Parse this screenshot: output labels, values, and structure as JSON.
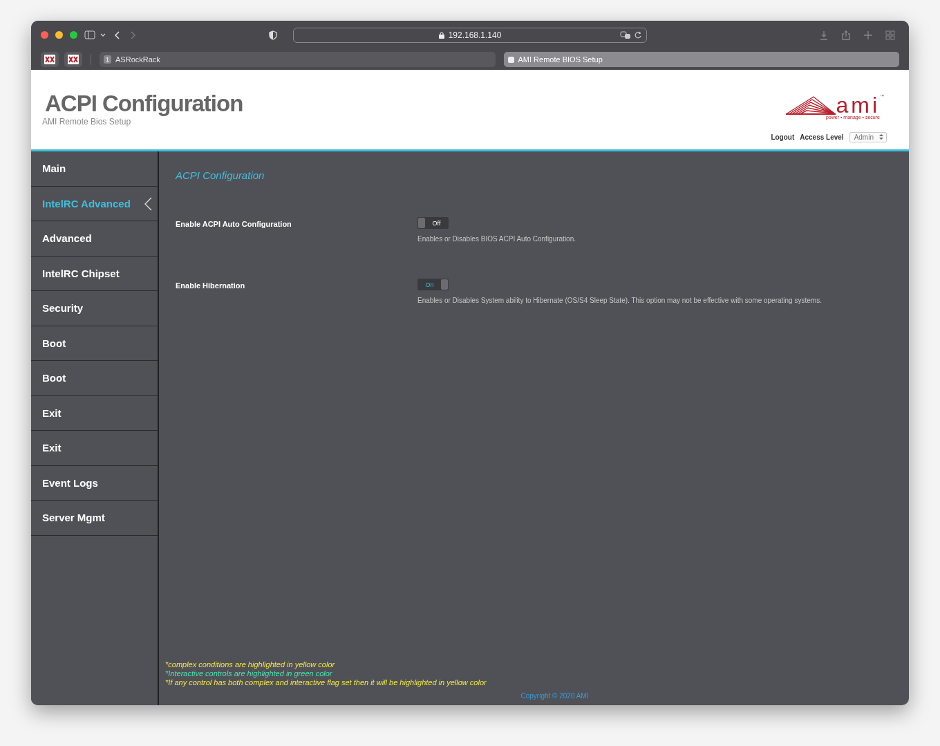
{
  "browser": {
    "url": "192.168.1.140",
    "tabs": [
      {
        "label": "ASRockRack",
        "badge": "1",
        "selected": false
      },
      {
        "label": "AMI Remote BIOS Setup",
        "selected": true
      }
    ]
  },
  "header": {
    "title": "ACPI Configuration",
    "subtitle": "AMI Remote Bios Setup",
    "logo": {
      "wordmark": "ami",
      "tm": "™",
      "tagline": "power • manage • secure"
    },
    "logout": "Logout",
    "access_level_label": "Access Level",
    "access_level": "Admin"
  },
  "sidebar": {
    "items": [
      {
        "label": "Main",
        "selected": false
      },
      {
        "label": "IntelRC Advanced",
        "selected": true
      },
      {
        "label": "Advanced",
        "selected": false
      },
      {
        "label": "IntelRC Chipset",
        "selected": false
      },
      {
        "label": "Security",
        "selected": false
      },
      {
        "label": "Boot",
        "selected": false
      },
      {
        "label": "Boot",
        "selected": false
      },
      {
        "label": "Exit",
        "selected": false
      },
      {
        "label": "Exit",
        "selected": false
      },
      {
        "label": "Event Logs",
        "selected": false
      },
      {
        "label": "Server Mgmt",
        "selected": false
      }
    ]
  },
  "content": {
    "heading": "ACPI Configuration",
    "settings": [
      {
        "label": "Enable ACPI Auto Configuration",
        "on": false,
        "state_text": "Off",
        "description": "Enables or Disables BIOS ACPI Auto Configuration."
      },
      {
        "label": "Enable Hibernation",
        "on": true,
        "state_text": "On",
        "description": "Enables or Disables System ability to Hibernate (OS/S4 Sleep State). This option may not be effective with some operating systems."
      }
    ]
  },
  "notes": [
    {
      "text": "*complex conditions are highlighted in yellow color",
      "color": "#f2e93a"
    },
    {
      "text": "*Interactive controls are highlighted in green color",
      "color": "#4fe0b0"
    },
    {
      "text": "*If any control has both complex and interactive flag set then it will be highlighted in yellow color",
      "color": "#f2e93a"
    }
  ],
  "copyright": "Copyright © 2020 AMI"
}
